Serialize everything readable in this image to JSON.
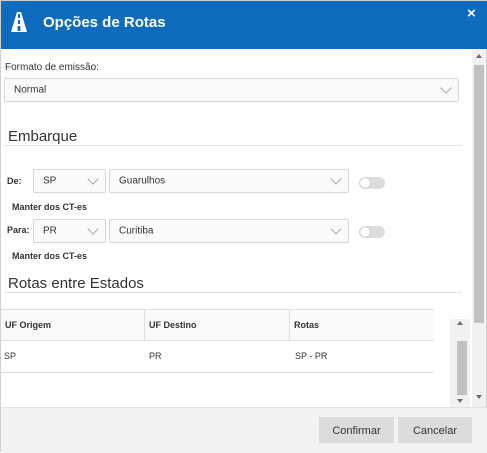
{
  "window": {
    "title": "Opções de Rotas",
    "close_label": "×",
    "accent_color": "#0f6cbd"
  },
  "format": {
    "label": "Formato de emissão:",
    "selected": "Normal"
  },
  "embarque": {
    "title": "Embarque",
    "from": {
      "label": "De:",
      "uf": "SP",
      "city": "Guarulhos",
      "keep_label": "Manter dos CT-es",
      "keep_on": false
    },
    "to": {
      "label": "Para:",
      "uf": "PR",
      "city": "Curitiba",
      "keep_label": "Manter dos CT-es",
      "keep_on": false
    }
  },
  "routes": {
    "title": "Rotas entre Estados",
    "columns": [
      "UF Origem",
      "UF Destino",
      "Rotas"
    ],
    "rows": [
      {
        "origin": "SP",
        "destination": "PR",
        "route": "SP - PR"
      }
    ]
  },
  "footer": {
    "confirm_label": "Confirmar",
    "cancel_label": "Cancelar"
  },
  "icons": {
    "logo": "road-icon",
    "close": "close-icon",
    "chevron": "chevron-down-icon"
  }
}
